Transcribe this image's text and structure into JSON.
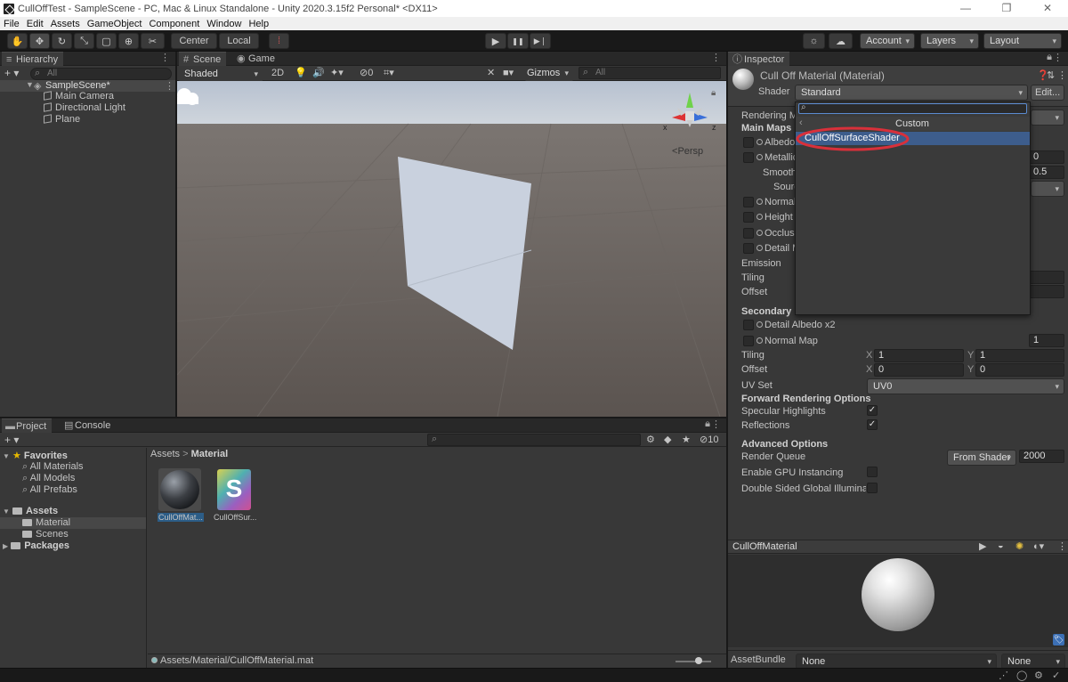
{
  "window": {
    "title": "CullOffTest - SampleScene - PC, Mac & Linux Standalone - Unity 2020.3.15f2 Personal* <DX11>",
    "min": "—",
    "max": "❐",
    "close": "✕"
  },
  "menu": [
    "File",
    "Edit",
    "Assets",
    "GameObject",
    "Component",
    "Window",
    "Help"
  ],
  "toolbar": {
    "center": "Center",
    "local": "Local",
    "account": "Account",
    "layers": "Layers",
    "layout": "Layout",
    "play": "▶",
    "pause": "❚❚",
    "step": "▶❘"
  },
  "hierarchy": {
    "tab": "Hierarchy",
    "add": "+ ▾",
    "search": "All",
    "scene": "SampleScene*",
    "items": [
      "Main Camera",
      "Directional Light",
      "Plane"
    ]
  },
  "scene": {
    "tab_scene": "Scene",
    "tab_game": "Game",
    "shading": "Shaded",
    "mode2d": "2D",
    "gizmos": "Gizmos",
    "search": "All",
    "persp": "Persp",
    "fx_count": "0",
    "axis_x": "x",
    "axis_z": "z"
  },
  "project": {
    "tab_project": "Project",
    "tab_console": "Console",
    "add": "+ ▾",
    "search": "",
    "count": "10",
    "breadcrumb_root": "Assets",
    "breadcrumb_sep": ">",
    "breadcrumb_leaf": "Material",
    "favorites": "Favorites",
    "fav_items": [
      "All Materials",
      "All Models",
      "All Prefabs"
    ],
    "assets": "Assets",
    "asset_items": [
      "Material",
      "Scenes"
    ],
    "packages": "Packages",
    "files": [
      {
        "name": "CullOffMat...",
        "kind": "material"
      },
      {
        "name": "CullOffSur...",
        "kind": "shader",
        "glyph": "S"
      }
    ],
    "path": "Assets/Material/CullOffMaterial.mat"
  },
  "inspector": {
    "tab": "Inspector",
    "material_title": "Cull Off Material (Material)",
    "shader_label": "Shader",
    "shader_value": "Standard",
    "edit_label": "Edit...",
    "labels": {
      "rendering_mode": "Rendering Mo",
      "main_maps": "Main Maps",
      "albedo": "Albedo",
      "metallic": "Metallic",
      "smooth": "Smooth",
      "source": "Sourc",
      "normal": "Normal",
      "height": "Height M",
      "occlusion": "Occlusi",
      "detail": "Detail M",
      "emission": "Emission",
      "tiling": "Tiling",
      "offset": "Offset",
      "secondary": "Secondary M",
      "detail_albedo": "Detail Albedo x2",
      "normal_map": "Normal Map",
      "tiling2": "Tiling",
      "offset2": "Offset",
      "uvset": "UV Set",
      "forward": "Forward Rendering Options",
      "specular": "Specular Highlights",
      "reflections": "Reflections",
      "advanced": "Advanced Options",
      "render_queue": "Render Queue",
      "gpu": "Enable GPU Instancing",
      "double_sided": "Double Sided Global Illuminati"
    },
    "values": {
      "metallic": "0",
      "smooth": "0.5",
      "normal_scale": "1",
      "tiling_x": "1",
      "tiling_y": "1",
      "offset_x": "0",
      "offset_y": "0",
      "x": "X",
      "y": "Y",
      "uvset": "UV0",
      "render_queue_mode": "From Shader",
      "render_queue": "2000"
    },
    "popup": {
      "search": "",
      "header": "Custom",
      "back": "‹",
      "item": "CullOffSurfaceShader"
    },
    "preview_title": "CullOffMaterial",
    "assetbundle_label": "AssetBundle",
    "assetbundle_value": "None",
    "assetbundle_variant": "None"
  },
  "colors": {
    "highlight": "#3d5d8c",
    "circle": "#d9303a",
    "plane": "#c9d1de",
    "sky": "#c4ccd8",
    "ground": "#5e5753"
  }
}
